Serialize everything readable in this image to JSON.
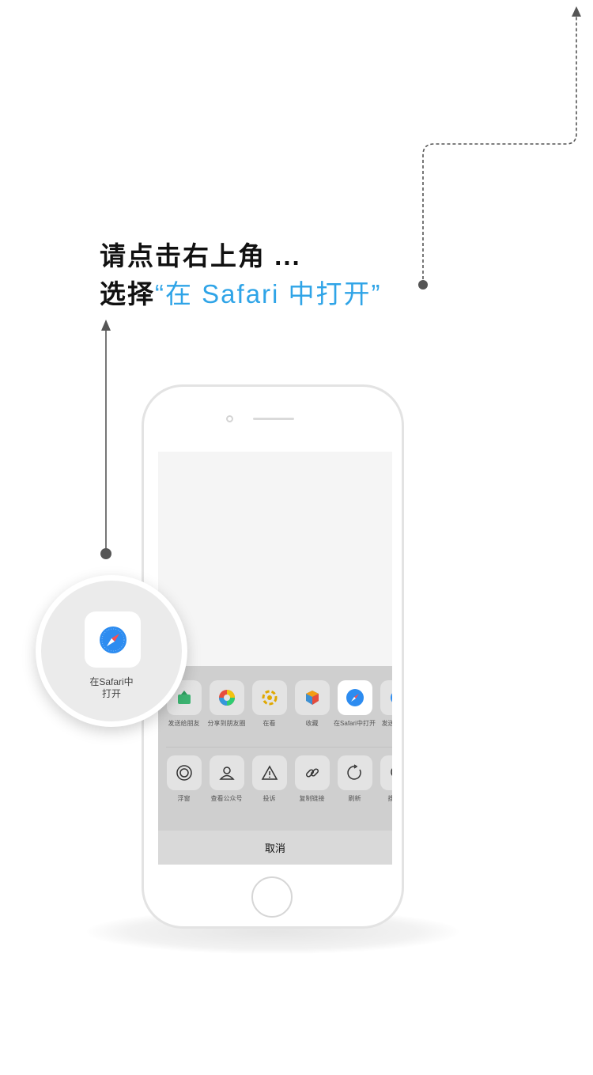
{
  "instruction": {
    "line1": "请点击右上角 ...",
    "line2_prefix": "选择",
    "line2_highlight": "“在 Safari 中打开”"
  },
  "colors": {
    "highlight": "#2fa4e7",
    "sheet_background": "#cfcfcf",
    "guide_line": "#555555"
  },
  "share_sheet": {
    "row1": [
      {
        "label": "发送给朋友",
        "icon": "send-to-friend-icon"
      },
      {
        "label": "分享到朋友圈",
        "icon": "moments-icon"
      },
      {
        "label": "在看",
        "icon": "wow-icon"
      },
      {
        "label": "收藏",
        "icon": "favorites-icon"
      },
      {
        "label": "在Safari中打开",
        "icon": "safari-icon"
      },
      {
        "label": "发送邮件的",
        "icon": "mail-icon"
      }
    ],
    "row2": [
      {
        "label": "浮窗",
        "icon": "float-window-icon"
      },
      {
        "label": "查看公众号",
        "icon": "official-account-icon"
      },
      {
        "label": "投诉",
        "icon": "warning-icon"
      },
      {
        "label": "复制链接",
        "icon": "link-icon"
      },
      {
        "label": "刷新",
        "icon": "refresh-icon"
      },
      {
        "label": "搜索页",
        "icon": "search-icon"
      }
    ],
    "cancel": "取消"
  },
  "zoom": {
    "label_line1": "在Safari中",
    "label_line2": "打开",
    "icon": "safari-icon"
  }
}
